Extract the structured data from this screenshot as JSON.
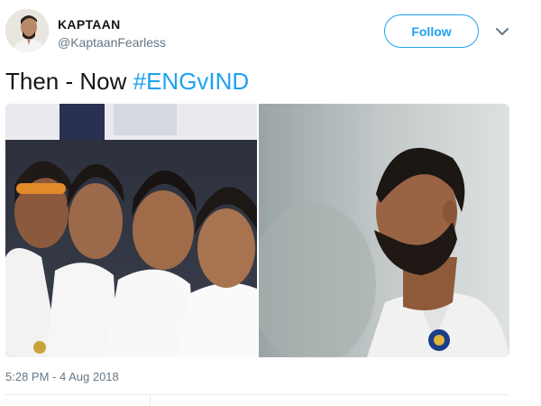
{
  "tweet": {
    "author": {
      "name": "KAPTAAN",
      "handle": "@KaptaanFearless"
    },
    "follow_label": "Follow",
    "text": {
      "plain": "Then - Now ",
      "hashtag": "#ENGvIND"
    },
    "timestamp": "5:28 PM - 4 Aug 2018",
    "media": {
      "left": "photo-then-team-group",
      "right": "photo-now-player-profile"
    }
  },
  "colors": {
    "accent": "#1da1f2",
    "text": "#14171a",
    "muted": "#657786",
    "divider": "#e6ecf0"
  },
  "icons": {
    "caret": "chevron-down-icon"
  }
}
